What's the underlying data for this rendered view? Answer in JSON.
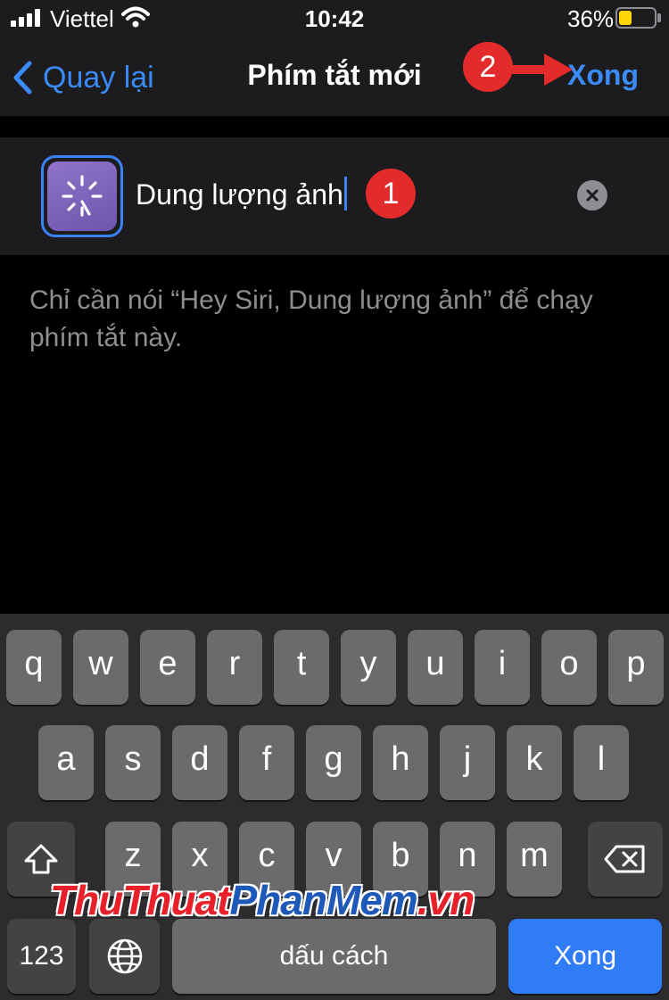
{
  "status_bar": {
    "carrier": "Viettel",
    "time": "10:42",
    "battery_percent": "36%",
    "battery_level": 0.36,
    "battery_color": "#ffd60a"
  },
  "nav": {
    "back_label": "Quay lại",
    "title": "Phím tắt mới",
    "done_label": "Xong"
  },
  "annotations": {
    "step1": "1",
    "step2": "2",
    "color": "#e42b2b"
  },
  "shortcut": {
    "icon": "magic-wand-icon",
    "name_value": "Dung lượng ảnh",
    "icon_color": "#7d63bd"
  },
  "hint_text": "Chỉ cần nói “Hey Siri, Dung lượng ảnh” để chạy phím tắt này.",
  "keyboard": {
    "row1": [
      "q",
      "w",
      "e",
      "r",
      "t",
      "y",
      "u",
      "i",
      "o",
      "p"
    ],
    "row2": [
      "a",
      "s",
      "d",
      "f",
      "g",
      "h",
      "j",
      "k",
      "l"
    ],
    "row3": [
      "z",
      "x",
      "c",
      "v",
      "b",
      "n",
      "m"
    ],
    "numbers_label": "123",
    "space_label": "dấu cách",
    "return_label": "Xong",
    "accent": "#2f7cf6"
  },
  "watermark": {
    "part1": "ThuThuat",
    "part2": "PhanMem",
    "part3": ".vn"
  }
}
